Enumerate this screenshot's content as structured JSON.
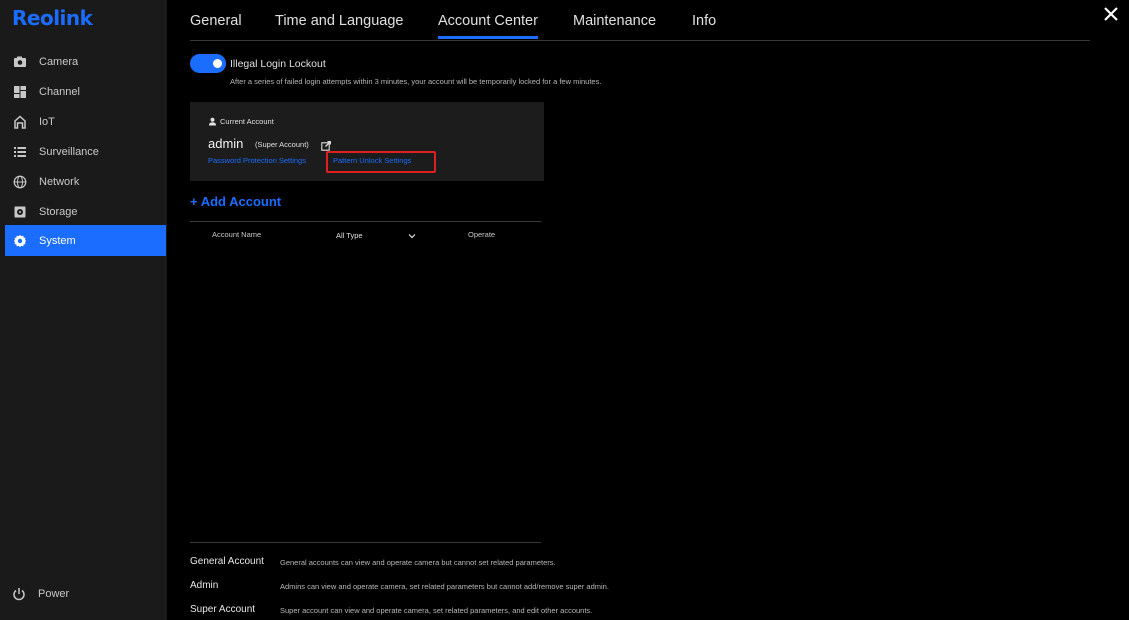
{
  "brand": {
    "logo_text": "Reolink",
    "accent_color": "#1a6dff"
  },
  "sidebar": {
    "items": [
      {
        "label": "Camera",
        "icon": "camera-icon"
      },
      {
        "label": "Channel",
        "icon": "channel-icon"
      },
      {
        "label": "IoT",
        "icon": "iot-icon"
      },
      {
        "label": "Surveillance",
        "icon": "surveillance-icon"
      },
      {
        "label": "Network",
        "icon": "network-icon"
      },
      {
        "label": "Storage",
        "icon": "storage-icon"
      },
      {
        "label": "System",
        "icon": "gear-icon",
        "active": true
      }
    ],
    "power_label": "Power"
  },
  "tabs": [
    {
      "label": "General"
    },
    {
      "label": "Time and Language"
    },
    {
      "label": "Account Center",
      "active": true
    },
    {
      "label": "Maintenance"
    },
    {
      "label": "Info"
    }
  ],
  "lockout": {
    "enabled": true,
    "label": "Illegal Login Lockout",
    "description": "After a series of failed login attempts within 3 minutes, your account will be temporarily locked for a few minutes."
  },
  "current_account": {
    "section_label": "Current Account",
    "name": "admin",
    "type": "(Super Account)",
    "password_link": "Password Protection Settings",
    "pattern_link": "Pattern Unlock Settings",
    "highlight_color": "#e02020"
  },
  "add_account_label": "+ Add Account",
  "table": {
    "col_name": "Account Name",
    "type_filter": "All Type",
    "col_operate": "Operate"
  },
  "legend": [
    {
      "term": "General Account",
      "desc": "General accounts can view and operate camera but cannot set related parameters."
    },
    {
      "term": "Admin",
      "desc": "Admins can view and operate camera, set related parameters but cannot add/remove super admin."
    },
    {
      "term": "Super Account",
      "desc": "Super account can view and operate camera, set related parameters, and edit other accounts."
    }
  ]
}
